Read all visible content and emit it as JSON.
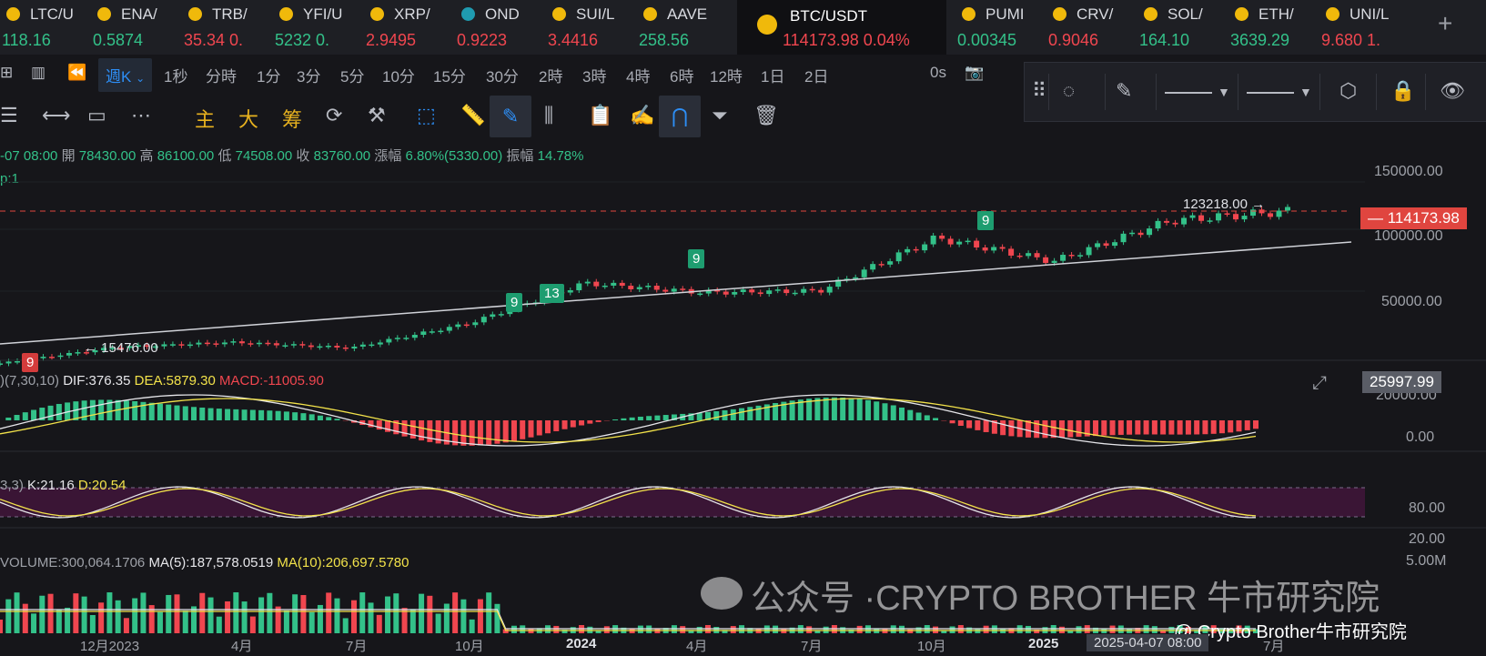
{
  "tickers": [
    {
      "symbol": "LTC/U",
      "price": "118.16",
      "change": "",
      "color": "#33c189",
      "icon": "litecoin-icon"
    },
    {
      "symbol": "ENA/",
      "price": "0.5874",
      "change": "",
      "color": "#33c189",
      "icon": "binance-icon"
    },
    {
      "symbol": "TRB/",
      "price": "35.34",
      "change": "0.",
      "color": "#f0464f",
      "icon": "binance-icon"
    },
    {
      "symbol": "YFI/U",
      "price": "5232",
      "change": "0.",
      "color": "#33c189",
      "icon": "binance-icon"
    },
    {
      "symbol": "XRP/",
      "price": "2.9495",
      "change": "",
      "color": "#f0464f",
      "icon": "binance-icon"
    },
    {
      "symbol": "OND",
      "price": "0.9223",
      "change": "",
      "color": "#f0464f",
      "icon": "ondo-icon"
    },
    {
      "symbol": "SUI/L",
      "price": "3.4416",
      "change": "",
      "color": "#f0464f",
      "icon": "binance-icon"
    },
    {
      "symbol": "AAVE",
      "price": "258.56",
      "change": "",
      "color": "#33c189",
      "icon": "binance-icon"
    },
    {
      "symbol": "BTC/USDT",
      "price": "114173.98",
      "change": "0.04%",
      "color": "#f0464f",
      "icon": "binance-icon",
      "active": true
    },
    {
      "symbol": "PUMI",
      "price": "0.00345",
      "change": "",
      "color": "#33c189",
      "icon": "binance-icon"
    },
    {
      "symbol": "CRV/",
      "price": "0.9046",
      "change": "",
      "color": "#f0464f",
      "icon": "binance-icon"
    },
    {
      "symbol": "SOL/",
      "price": "164.10",
      "change": "",
      "color": "#33c189",
      "icon": "binance-icon"
    },
    {
      "symbol": "ETH/",
      "price": "3639.29",
      "change": "",
      "color": "#33c189",
      "icon": "binance-icon"
    },
    {
      "symbol": "UNI/L",
      "price": "9.680",
      "change": "1.",
      "color": "#f0464f",
      "icon": "binance-icon"
    }
  ],
  "add_tab_label": "+",
  "timeframes": {
    "selected": "週K",
    "options": [
      "1秒",
      "分時",
      "1分",
      "3分",
      "5分",
      "10分",
      "15分",
      "30分",
      "2時",
      "3時",
      "4時",
      "6時",
      "12時",
      "1日",
      "2日"
    ],
    "extra": "0s"
  },
  "indicator_tabs": [
    "主",
    "大",
    "筹"
  ],
  "ohlc": {
    "date": "-07 08:00",
    "open_label": "開",
    "open": "78430.00",
    "high_label": "高",
    "high": "86100.00",
    "low_label": "低",
    "low": "74508.00",
    "close_label": "收",
    "close": "83760.00",
    "change_label": "漲幅",
    "change": "6.80%(5330.00)",
    "amp_label": "振幅",
    "amp": "14.78%"
  },
  "main_overlay_label": "p:1",
  "price_axis": [
    "150000.00",
    "100000.00",
    "50000.00"
  ],
  "last_price": "114173.98",
  "high_marker": "123218.00",
  "low_marker": "15476.00",
  "td_markers": [
    "9",
    "9",
    "13",
    "9",
    "9"
  ],
  "macd": {
    "params": ")(7,30,10)",
    "dif": "DIF:376.35",
    "dea": "DEA:5879.30",
    "macd": "MACD:-11005.90",
    "axis": [
      "20000.00",
      "0.00"
    ],
    "crosshair_value": "25997.99"
  },
  "kd": {
    "params": "3,3)",
    "k": "K:21.16",
    "d": "D:20.54",
    "axis": [
      "80.00",
      "20.00"
    ]
  },
  "volume": {
    "label": "VOLUME:300,064.1706",
    "ma5": "MA(5):187,578.0519",
    "ma10": "MA(10):206,697.5780",
    "axis": [
      "5.00M"
    ]
  },
  "x_axis": [
    "12月2023",
    "4月",
    "7月",
    "10月",
    "2024",
    "4月",
    "7月",
    "10月",
    "2025",
    "7月"
  ],
  "crosshair_date": "2025-04-07 08:00",
  "watermark": "公众号 ·CRYPTO BROTHER 牛市研究院",
  "credit": "@ Crypto Brother牛市研究院",
  "colors": {
    "up": "#33c189",
    "down": "#f0464f",
    "accent": "#2d8ef5",
    "kd_band": "#3a1535"
  },
  "chart_data": {
    "type": "line",
    "title": "",
    "x": [
      "2022-11",
      "2023-03",
      "2023-06",
      "2023-09",
      "2023-12",
      "2024-03",
      "2024-06",
      "2024-09",
      "2024-12",
      "2025-03",
      "2025-06",
      "2025-08"
    ],
    "series": [
      {
        "values": [
          16500,
          27000,
          30000,
          26500,
          42000,
          68000,
          62000,
          63000,
          97000,
          82000,
          108000,
          114174
        ]
      }
    ],
    "ylabel": "",
    "ylim": [
      0,
      160000
    ]
  }
}
